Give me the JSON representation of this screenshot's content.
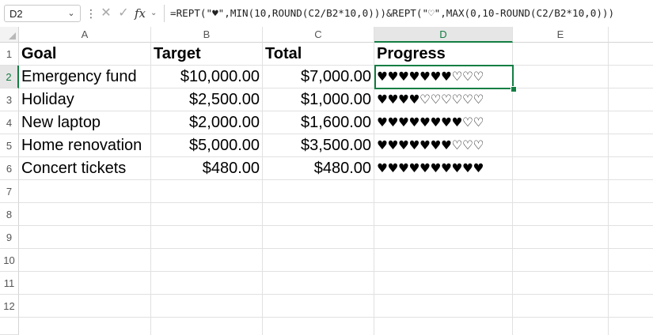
{
  "formula_bar": {
    "name_box": "D2",
    "cancel_icon": "x-icon",
    "enter_icon": "check-icon",
    "fx_label": "fx",
    "formula": "=REPT(\"♥\",MIN(10,ROUND(C2/B2*10,0)))&REPT(\"♡\",MAX(0,10-ROUND(C2/B2*10,0)))"
  },
  "columns": [
    "A",
    "B",
    "C",
    "D",
    "E"
  ],
  "selected_column": "D",
  "rows": [
    "1",
    "2",
    "3",
    "4",
    "5",
    "6",
    "7",
    "8",
    "9",
    "10",
    "11",
    "12"
  ],
  "selected_row": "2",
  "header_row": {
    "goal": "Goal",
    "target": "Target",
    "total": "Total",
    "progress": "Progress"
  },
  "data_rows": [
    {
      "goal": "Emergency fund",
      "target": "$10,000.00",
      "total": "$7,000.00",
      "progress": "♥♥♥♥♥♥♥♡♡♡"
    },
    {
      "goal": "Holiday",
      "target": "$2,500.00",
      "total": "$1,000.00",
      "progress": "♥♥♥♥♡♡♡♡♡♡"
    },
    {
      "goal": "New laptop",
      "target": "$2,000.00",
      "total": "$1,600.00",
      "progress": "♥♥♥♥♥♥♥♥♡♡"
    },
    {
      "goal": "Home renovation",
      "target": "$5,000.00",
      "total": "$3,500.00",
      "progress": "♥♥♥♥♥♥♥♡♡♡"
    },
    {
      "goal": "Concert tickets",
      "target": "$480.00",
      "total": "$480.00",
      "progress": "♥♥♥♥♥♥♥♥♥♥"
    }
  ],
  "colors": {
    "selection": "#137e43",
    "header_selected_bg": "#e6e6e6",
    "gridline": "#e1e1e1"
  }
}
